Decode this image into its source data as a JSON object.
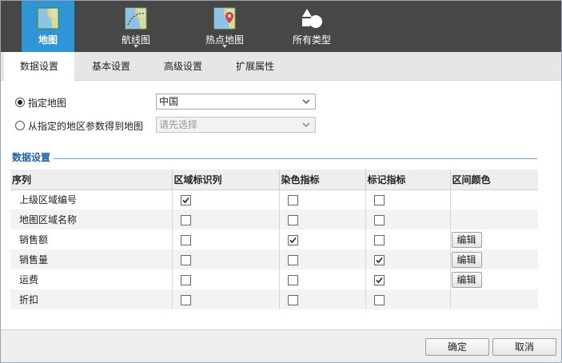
{
  "toolbar": {
    "items": [
      {
        "label": "地图",
        "icon": "map-icon",
        "active": true
      },
      {
        "label": "航线图",
        "icon": "route-map-icon",
        "active": false
      },
      {
        "label": "热点地图",
        "icon": "hotspot-map-icon",
        "active": false
      },
      {
        "label": "所有类型",
        "icon": "shapes-icon",
        "active": false
      }
    ]
  },
  "tabs": [
    {
      "label": "数据设置",
      "active": true
    },
    {
      "label": "基本设置",
      "active": false
    },
    {
      "label": "高级设置",
      "active": false
    },
    {
      "label": "扩展属性",
      "active": false
    }
  ],
  "map_source": {
    "option1": {
      "label": "指定地图",
      "checked": true,
      "select_value": "中国"
    },
    "option2": {
      "label": "从指定的地区参数得到地图",
      "checked": false,
      "select_placeholder": "请先选择"
    }
  },
  "section": {
    "title": "数据设置"
  },
  "table": {
    "headers": [
      "序列",
      "区域标识列",
      "染色指标",
      "标记指标",
      "区间颜色"
    ],
    "rows": [
      {
        "name": "上级区域编号",
        "region_id": true,
        "color_metric": false,
        "mark_metric": false,
        "edit": false
      },
      {
        "name": "地图区域名称",
        "region_id": false,
        "color_metric": false,
        "mark_metric": false,
        "edit": false
      },
      {
        "name": "销售额",
        "region_id": false,
        "color_metric": true,
        "mark_metric": false,
        "edit": true
      },
      {
        "name": "销售量",
        "region_id": false,
        "color_metric": false,
        "mark_metric": true,
        "edit": true
      },
      {
        "name": "运费",
        "region_id": false,
        "color_metric": false,
        "mark_metric": true,
        "edit": true
      },
      {
        "name": "折扣",
        "region_id": false,
        "color_metric": false,
        "mark_metric": false,
        "edit": false
      }
    ],
    "edit_label": "编辑"
  },
  "footer": {
    "ok_label": "确定",
    "cancel_label": "取消"
  },
  "colors": {
    "toolbar_bg": "#474747",
    "active_toolbar": "#2f95d4",
    "section_title": "#1e5fa8"
  }
}
